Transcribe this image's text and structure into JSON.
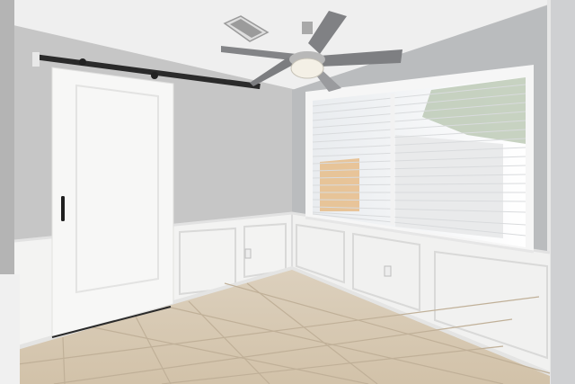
{
  "scene": {
    "kind": "photo",
    "subject": "empty room",
    "colors": {
      "ceiling": "#efefef",
      "wall_left": "#c6c6c6",
      "wall_right": "#b9bbbd",
      "wainscot": "#f3f3f2",
      "floor": "#d8cbb6",
      "grout": "#bfae95",
      "door": "#f7f7f6",
      "rail": "#2a2a2a",
      "blind": "#f2f3f4",
      "fan_blade": "#7f8083",
      "fan_light": "#f4f0e6"
    },
    "icons": [
      "ceiling-fan-icon",
      "air-vent-icon",
      "door-handle-icon",
      "outlet-icon"
    ]
  }
}
